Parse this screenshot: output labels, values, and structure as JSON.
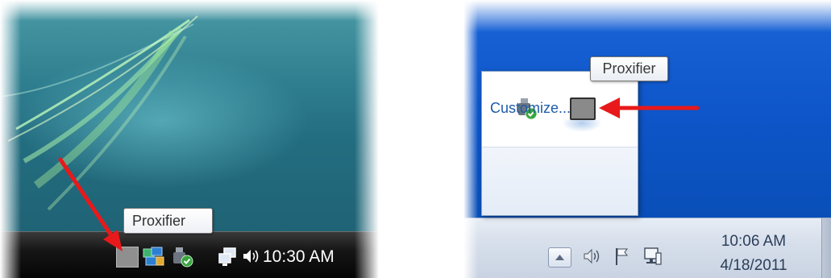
{
  "vista": {
    "tooltip": "Proxifier",
    "clock": "10:30 AM",
    "tray_icons": [
      "proxifier-icon",
      "network-status-icon",
      "usb-safely-remove-icon",
      "monitor-network-icon",
      "speaker-icon"
    ]
  },
  "win7": {
    "tooltip": "Proxifier",
    "customize_label": "Customize...",
    "clock_time": "10:06 AM",
    "clock_date": "4/18/2011",
    "tray_icons": [
      "show-hidden-icons-icon",
      "speaker-icon",
      "action-center-flag-icon",
      "network-icon"
    ],
    "overflow_icons": [
      "usb-safely-remove-icon",
      "proxifier-icon"
    ]
  },
  "colors": {
    "annotation_arrow": "#e8191b",
    "vista_taskbar": "#111111",
    "win7_desktop": "#0d55c8",
    "win7_link": "#1c5ba8"
  }
}
